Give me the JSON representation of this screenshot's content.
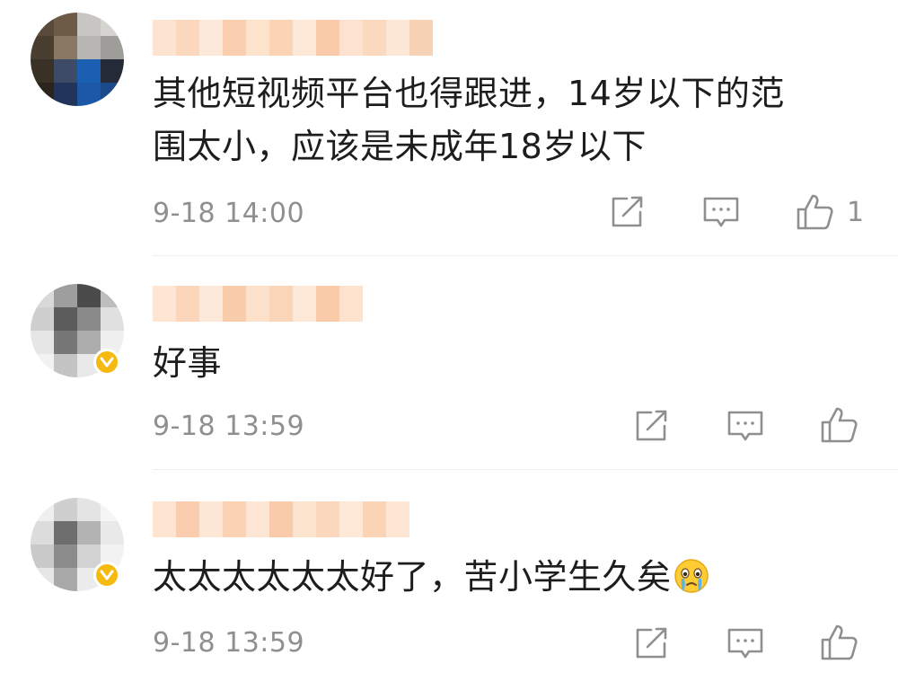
{
  "comments": [
    {
      "text_line1": "其他短视频平台也得跟进，14岁以下的范",
      "text_line2": "围太小，应该是未成年18岁以下",
      "timestamp": "9-18 14:00",
      "like_count": "1",
      "verified": false
    },
    {
      "text_line1": "好事",
      "timestamp": "9-18 13:59",
      "like_count": "",
      "verified": true
    },
    {
      "text_line1": "太太太太太太好了，苦小学生久矣",
      "emoji": "crying-face-emoji",
      "timestamp": "9-18 13:59",
      "like_count": "",
      "verified": true
    }
  ],
  "icons": {
    "share": "share-icon",
    "comment": "comment-icon",
    "like": "like-icon",
    "verified": "verified-badge-icon"
  },
  "colors": {
    "text": "#1d1d1d",
    "meta": "#8f8f8f",
    "badge": "#f5b90f",
    "username_blur": "#f8c9a6"
  }
}
